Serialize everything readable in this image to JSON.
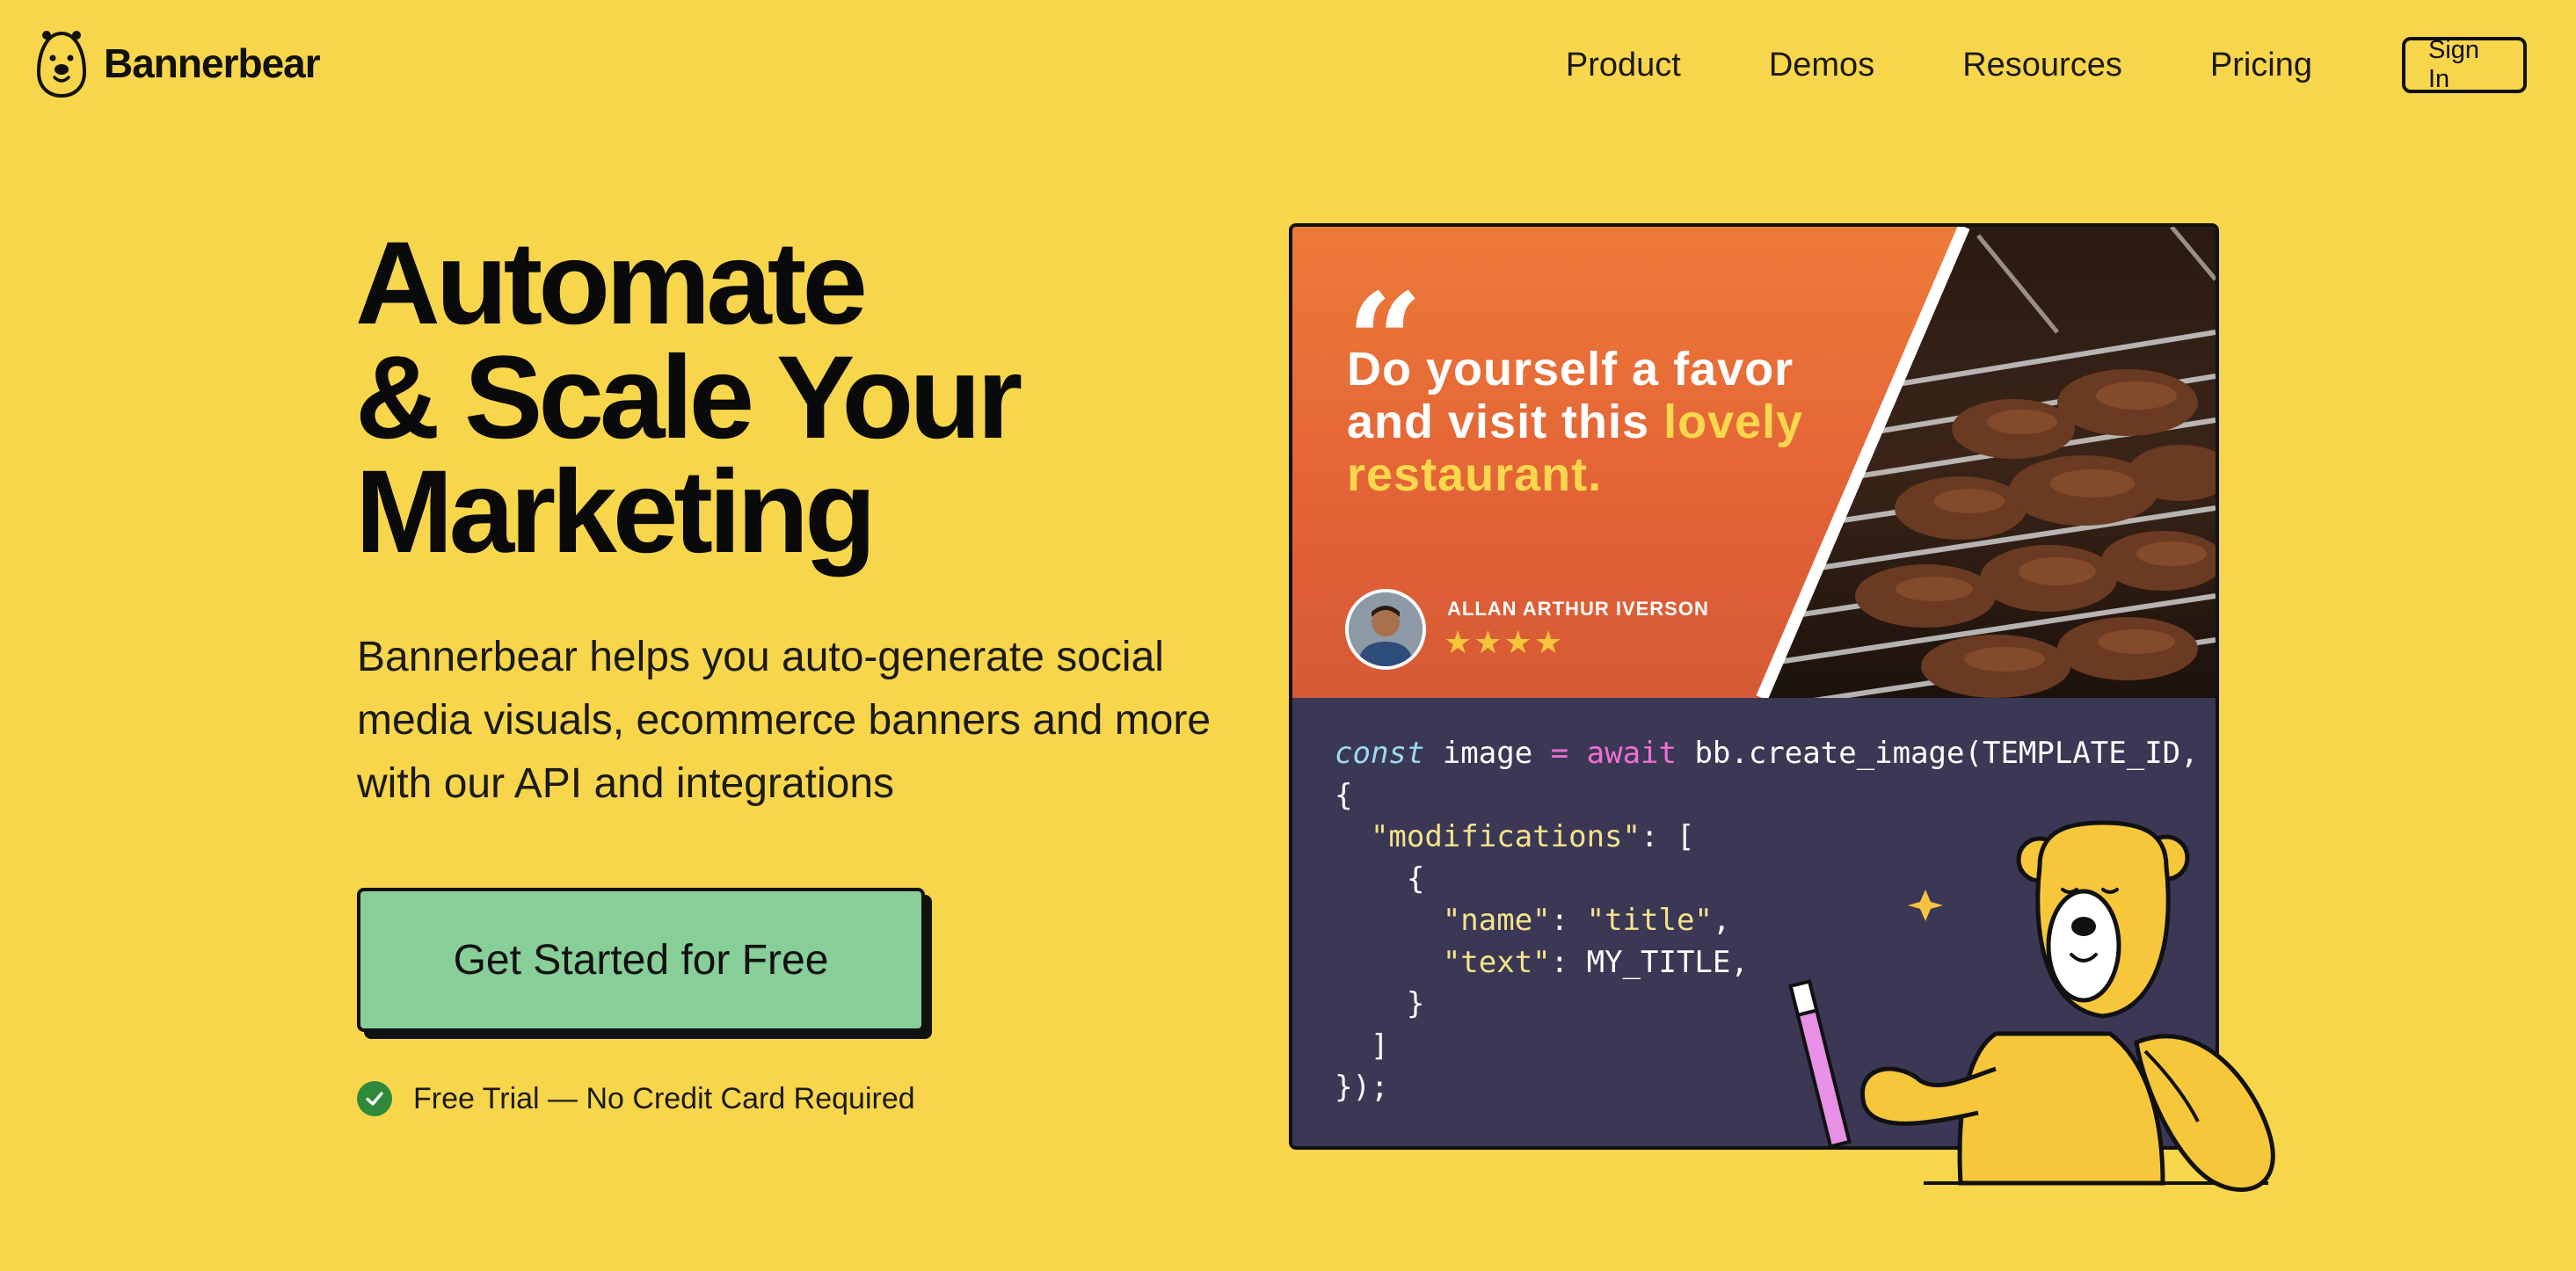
{
  "nav": {
    "brand": "Bannerbear",
    "items": [
      {
        "label": "Product"
      },
      {
        "label": "Demos"
      },
      {
        "label": "Resources"
      },
      {
        "label": "Pricing"
      }
    ],
    "sign_in": "Sign In"
  },
  "hero": {
    "headline": "Automate\n& Scale Your\nMarketing",
    "subtext": "Bannerbear helps you auto-generate social media visuals, ecommerce banners and more with our API and integrations",
    "cta_label": "Get Started for Free",
    "trial_note": "Free Trial — No Credit Card Required"
  },
  "card": {
    "quote_mark": "“",
    "quote_pre": "Do yourself a favor and visit this ",
    "quote_highlight": "lovely restaurant.",
    "author": "ALLAN ARTHUR IVERSON",
    "stars": "★★★★",
    "rating": 4,
    "code": {
      "line1_const": "const",
      "line1_var": " image ",
      "line1_eq": "=",
      "line1_await": "await",
      "line1_rest": " bb.create_image(TEMPLATE_ID,",
      "line2": "{",
      "line3_key": "\"modifications\"",
      "line3_rest": ": [",
      "line4": "    {",
      "line5_key": "\"name\"",
      "line5_mid": ": ",
      "line5_val": "\"title\"",
      "line5_end": ",",
      "line6_key": "\"text\"",
      "line6_rest": ": MY_TITLE,",
      "line7": "    }",
      "line8": "  ]",
      "line9": "});"
    }
  },
  "colors": {
    "background": "#F8D64B",
    "cta": "#88CE98",
    "code_bg": "#3A3855",
    "banner_orange": "#E96A36",
    "highlight": "#FBD74E",
    "check": "#2E8A3A"
  },
  "icons": {
    "logo": "bear-head-icon",
    "check": "check-circle-icon",
    "mascot": "bear-mascot"
  }
}
